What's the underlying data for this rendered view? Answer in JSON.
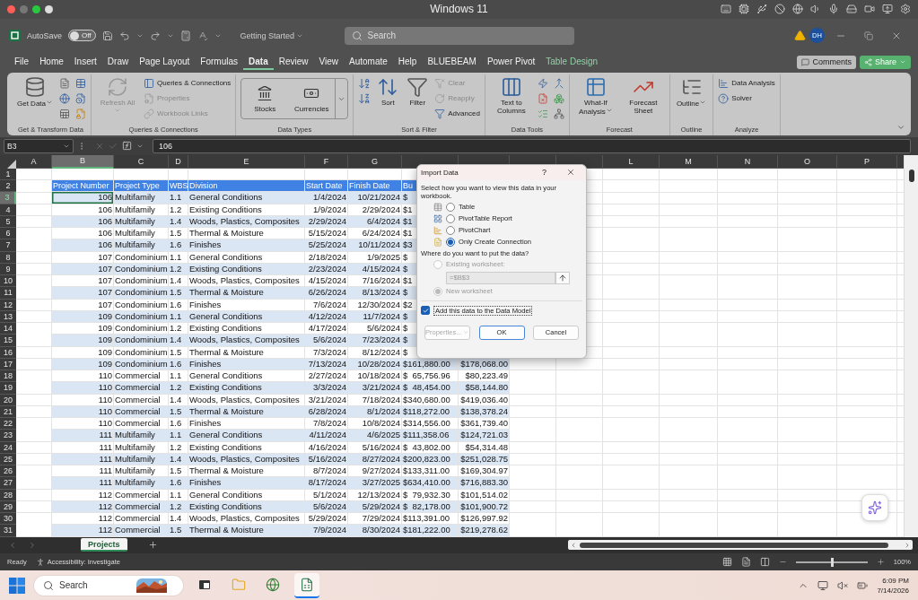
{
  "mac_titlebar": {
    "title": "Windows 11"
  },
  "app_titlebar": {
    "autosave_label": "AutoSave",
    "autosave": {
      "on": false,
      "label": "Off"
    },
    "document": "Getting Started",
    "search": {
      "placeholder": "Search"
    },
    "avatar": "DH"
  },
  "ribbon_tabs": [
    {
      "label": "File",
      "selected": false,
      "kind": "normal"
    },
    {
      "label": "Home",
      "selected": false,
      "kind": "normal"
    },
    {
      "label": "Insert",
      "selected": false,
      "kind": "normal"
    },
    {
      "label": "Draw",
      "selected": false,
      "kind": "normal"
    },
    {
      "label": "Page Layout",
      "selected": false,
      "kind": "normal"
    },
    {
      "label": "Formulas",
      "selected": false,
      "kind": "normal"
    },
    {
      "label": "Data",
      "selected": true,
      "kind": "normal"
    },
    {
      "label": "Review",
      "selected": false,
      "kind": "normal"
    },
    {
      "label": "View",
      "selected": false,
      "kind": "normal"
    },
    {
      "label": "Automate",
      "selected": false,
      "kind": "normal"
    },
    {
      "label": "Help",
      "selected": false,
      "kind": "normal"
    },
    {
      "label": "BLUEBEAM",
      "selected": false,
      "kind": "normal"
    },
    {
      "label": "Power Pivot",
      "selected": false,
      "kind": "normal"
    },
    {
      "label": "Table Design",
      "selected": false,
      "kind": "contextual"
    }
  ],
  "ribbon_actions": {
    "comments": "Comments",
    "share": "Share"
  },
  "ribbon_groups": [
    {
      "title": "Get & Transform Data",
      "items": [
        {
          "kind": "large",
          "label": "Get Data",
          "menu": true,
          "disabled": false
        }
      ]
    },
    {
      "title": "Queries & Connections",
      "items": [
        {
          "kind": "large",
          "label": "Refresh All",
          "menu": true,
          "disabled": true
        },
        {
          "kind": "small",
          "label": "Queries & Connections",
          "menu": false,
          "disabled": false
        },
        {
          "kind": "small",
          "label": "Properties",
          "menu": false,
          "disabled": true
        },
        {
          "kind": "small",
          "label": "Workbook Links",
          "menu": false,
          "disabled": true
        }
      ]
    },
    {
      "title": "Data Types",
      "items": [
        {
          "kind": "gallery",
          "label": "Stocks",
          "menu": false,
          "disabled": false
        },
        {
          "kind": "gallery",
          "label": "Currencies",
          "menu": false,
          "disabled": false
        }
      ]
    },
    {
      "title": "Sort & Filter",
      "items": [
        {
          "kind": "large",
          "label": "Sort",
          "menu": false,
          "disabled": false
        },
        {
          "kind": "large",
          "label": "Filter",
          "menu": false,
          "disabled": false
        },
        {
          "kind": "small",
          "label": "Clear",
          "menu": false,
          "disabled": true
        },
        {
          "kind": "small",
          "label": "Reapply",
          "menu": false,
          "disabled": true
        },
        {
          "kind": "small",
          "label": "Advanced",
          "menu": false,
          "disabled": false
        }
      ]
    },
    {
      "title": "Data Tools",
      "items": [
        {
          "kind": "large",
          "label": "Text to Columns",
          "menu": false,
          "disabled": false
        }
      ]
    },
    {
      "title": "Forecast",
      "items": [
        {
          "kind": "large",
          "label": "What-If Analysis",
          "menu": true,
          "disabled": false
        },
        {
          "kind": "large",
          "label": "Forecast Sheet",
          "menu": false,
          "disabled": false
        }
      ]
    },
    {
      "title": "Outline",
      "items": [
        {
          "kind": "large",
          "label": "Outline",
          "menu": true,
          "disabled": false
        }
      ]
    },
    {
      "title": "Analyze",
      "items": [
        {
          "kind": "small",
          "label": "Data Analysis",
          "menu": false,
          "disabled": false
        },
        {
          "kind": "small",
          "label": "Solver",
          "menu": false,
          "disabled": false
        }
      ]
    }
  ],
  "formula_bar": {
    "name_box": "B3",
    "formula": "106"
  },
  "sheet": {
    "column_headers": [
      {
        "letter": "A",
        "selected": false
      },
      {
        "letter": "B",
        "selected": true
      },
      {
        "letter": "C",
        "selected": false
      },
      {
        "letter": "D",
        "selected": false
      },
      {
        "letter": "E",
        "selected": false
      },
      {
        "letter": "F",
        "selected": false
      },
      {
        "letter": "G",
        "selected": false
      },
      {
        "selected": false
      },
      {
        "selected": false
      },
      {
        "selected": false
      },
      {
        "selected": false
      },
      {
        "letter": "L",
        "selected": false
      },
      {
        "letter": "M",
        "selected": false
      },
      {
        "letter": "N",
        "selected": false
      },
      {
        "letter": "O",
        "selected": false
      },
      {
        "letter": "P",
        "selected": false
      }
    ],
    "rows": [
      {
        "number": "1",
        "kind": "empty",
        "selected": false,
        "cells": []
      },
      {
        "number": "2",
        "kind": "header",
        "selected": false,
        "cells": [
          "Project Number",
          "Project Type",
          "WBS",
          "Division",
          "Start Date",
          "Finish Date",
          "Bu"
        ]
      },
      {
        "number": "3",
        "kind": "data",
        "selected": true,
        "cells": [
          "106",
          "Multifamily",
          "1.1",
          "General Conditions",
          "1/4/2024",
          "10/21/2024",
          "$"
        ]
      },
      {
        "number": "4",
        "kind": "data",
        "selected": false,
        "cells": [
          "106",
          "Multifamily",
          "1.2",
          "Existing Conditions",
          "1/9/2024",
          "2/29/2024",
          "$1"
        ]
      },
      {
        "number": "5",
        "kind": "data",
        "selected": false,
        "cells": [
          "106",
          "Multifamily",
          "1.4",
          "Woods, Plastics, Composites",
          "2/29/2024",
          "6/4/2024",
          "$1"
        ]
      },
      {
        "number": "6",
        "kind": "data",
        "selected": false,
        "cells": [
          "106",
          "Multifamily",
          "1.5",
          "Thermal & Moisture",
          "5/15/2024",
          "6/24/2024",
          "$1"
        ]
      },
      {
        "number": "7",
        "kind": "data",
        "selected": false,
        "cells": [
          "106",
          "Multifamily",
          "1.6",
          "Finishes",
          "5/25/2024",
          "10/11/2024",
          "$3"
        ]
      },
      {
        "number": "8",
        "kind": "data",
        "selected": false,
        "cells": [
          "107",
          "Condominium",
          "1.1",
          "General Conditions",
          "2/18/2024",
          "1/9/2025",
          "$"
        ]
      },
      {
        "number": "9",
        "kind": "data",
        "selected": false,
        "cells": [
          "107",
          "Condominium",
          "1.2",
          "Existing Conditions",
          "2/23/2024",
          "4/15/2024",
          "$"
        ]
      },
      {
        "number": "10",
        "kind": "data",
        "selected": false,
        "cells": [
          "107",
          "Condominium",
          "1.4",
          "Woods, Plastics, Composites",
          "4/15/2024",
          "7/16/2024",
          "$1"
        ]
      },
      {
        "number": "11",
        "kind": "data",
        "selected": false,
        "cells": [
          "107",
          "Condominium",
          "1.5",
          "Thermal & Moisture",
          "6/26/2024",
          "8/13/2024",
          "$"
        ]
      },
      {
        "number": "12",
        "kind": "data",
        "selected": false,
        "cells": [
          "107",
          "Condominium",
          "1.6",
          "Finishes",
          "7/6/2024",
          "12/30/2024",
          "$2"
        ]
      },
      {
        "number": "13",
        "kind": "data",
        "selected": false,
        "cells": [
          "109",
          "Condominium",
          "1.1",
          "General Conditions",
          "4/12/2024",
          "11/7/2024",
          "$"
        ]
      },
      {
        "number": "14",
        "kind": "data",
        "selected": false,
        "cells": [
          "109",
          "Condominium",
          "1.2",
          "Existing Conditions",
          "4/17/2024",
          "5/6/2024",
          "$"
        ]
      },
      {
        "number": "15",
        "kind": "data",
        "selected": false,
        "cells": [
          "109",
          "Condominium",
          "1.4",
          "Woods, Plastics, Composites",
          "5/6/2024",
          "7/23/2024",
          "$"
        ]
      },
      {
        "number": "16",
        "kind": "data",
        "selected": false,
        "cells": [
          "109",
          "Condominium",
          "1.5",
          "Thermal & Moisture",
          "7/3/2024",
          "8/12/2024",
          "$"
        ]
      },
      {
        "number": "17",
        "kind": "data",
        "selected": false,
        "cells": [
          "109",
          "Condominium",
          "1.6",
          "Finishes",
          "7/13/2024",
          "10/28/2024",
          "$161,880.00",
          "$178,068.00"
        ]
      },
      {
        "number": "18",
        "kind": "data",
        "selected": false,
        "cells": [
          "110",
          "Commercial",
          "1.1",
          "General Conditions",
          "2/27/2024",
          "10/18/2024",
          "$  65,756.96",
          "$80,223.49"
        ]
      },
      {
        "number": "19",
        "kind": "data",
        "selected": false,
        "cells": [
          "110",
          "Commercial",
          "1.2",
          "Existing Conditions",
          "3/3/2024",
          "3/21/2024",
          "$  48,454.00",
          "$58,144.80"
        ]
      },
      {
        "number": "20",
        "kind": "data",
        "selected": false,
        "cells": [
          "110",
          "Commercial",
          "1.4",
          "Woods, Plastics, Composites",
          "3/21/2024",
          "7/18/2024",
          "$340,680.00",
          "$419,036.40"
        ]
      },
      {
        "number": "21",
        "kind": "data",
        "selected": false,
        "cells": [
          "110",
          "Commercial",
          "1.5",
          "Thermal & Moisture",
          "6/28/2024",
          "8/1/2024",
          "$118,272.00",
          "$138,378.24"
        ]
      },
      {
        "number": "22",
        "kind": "data",
        "selected": false,
        "cells": [
          "110",
          "Commercial",
          "1.6",
          "Finishes",
          "7/8/2024",
          "10/8/2024",
          "$314,556.00",
          "$361,739.40"
        ]
      },
      {
        "number": "23",
        "kind": "data",
        "selected": false,
        "cells": [
          "111",
          "Multifamily",
          "1.1",
          "General Conditions",
          "4/11/2024",
          "4/6/2025",
          "$111,358.06",
          "$124,721.03"
        ]
      },
      {
        "number": "24",
        "kind": "data",
        "selected": false,
        "cells": [
          "111",
          "Multifamily",
          "1.2",
          "Existing Conditions",
          "4/16/2024",
          "5/16/2024",
          "$  43,802.00",
          "$54,314.48"
        ]
      },
      {
        "number": "25",
        "kind": "data",
        "selected": false,
        "cells": [
          "111",
          "Multifamily",
          "1.4",
          "Woods, Plastics, Composites",
          "5/16/2024",
          "8/27/2024",
          "$200,823.00",
          "$251,028.75"
        ]
      },
      {
        "number": "26",
        "kind": "data",
        "selected": false,
        "cells": [
          "111",
          "Multifamily",
          "1.5",
          "Thermal & Moisture",
          "8/7/2024",
          "9/27/2024",
          "$133,311.00",
          "$169,304.97"
        ]
      },
      {
        "number": "27",
        "kind": "data",
        "selected": false,
        "cells": [
          "111",
          "Multifamily",
          "1.6",
          "Finishes",
          "8/17/2024",
          "3/27/2025",
          "$634,410.00",
          "$716,883.30"
        ]
      },
      {
        "number": "28",
        "kind": "data",
        "selected": false,
        "cells": [
          "112",
          "Commercial",
          "1.1",
          "General Conditions",
          "5/1/2024",
          "12/13/2024",
          "$  79,932.30",
          "$101,514.02"
        ]
      },
      {
        "number": "29",
        "kind": "data",
        "selected": false,
        "cells": [
          "112",
          "Commercial",
          "1.2",
          "Existing Conditions",
          "5/6/2024",
          "5/29/2024",
          "$  82,178.00",
          "$101,900.72"
        ]
      },
      {
        "number": "30",
        "kind": "data",
        "selected": false,
        "cells": [
          "112",
          "Commercial",
          "1.4",
          "Woods, Plastics, Composites",
          "5/29/2024",
          "7/29/2024",
          "$113,391.00",
          "$126,997.92"
        ]
      },
      {
        "number": "31",
        "kind": "data",
        "selected": false,
        "cells": [
          "112",
          "Commercial",
          "1.5",
          "Thermal & Moisture",
          "7/9/2024",
          "8/30/2024",
          "$181,222.00",
          "$219,278.62"
        ]
      }
    ]
  },
  "dialog": {
    "title": "Import Data",
    "help": "?",
    "prompt": "Select how you want to view this data in your workbook.",
    "view_options": [
      {
        "label": "Table",
        "selected": false
      },
      {
        "label": "PivotTable Report",
        "selected": false
      },
      {
        "label": "PivotChart",
        "selected": false
      },
      {
        "label": "Only Create Connection",
        "selected": true
      }
    ],
    "placement_prompt": "Where do you want to put the data?",
    "placement_options": [
      {
        "label": "Existing worksheet:",
        "selected": false,
        "disabled": true
      },
      {
        "label": "New worksheet",
        "selected": true,
        "disabled": true
      }
    ],
    "range": "=$B$3",
    "data_model": {
      "label": "Add this data to the Data Model",
      "checked": true
    },
    "buttons": [
      {
        "label": "Properties...",
        "disabled": true,
        "menu": true,
        "default": false
      },
      {
        "label": "OK",
        "disabled": false,
        "menu": false,
        "default": true
      },
      {
        "label": "Cancel",
        "disabled": false,
        "menu": false,
        "default": false
      }
    ]
  },
  "sheet_tabs": [
    {
      "label": "Projects",
      "selected": true
    }
  ],
  "status_bar": {
    "ready": "Ready",
    "accessibility": "Accessibility: Investigate",
    "zoom": {
      "level": 0.5,
      "reading": "100%"
    }
  },
  "taskbar": {
    "search": {
      "placeholder": "Search"
    },
    "apps": [
      {
        "selected": false
      },
      {
        "selected": false
      },
      {
        "selected": false
      },
      {
        "selected": true
      }
    ],
    "time": "6:09 PM",
    "date": "7/14/2026"
  }
}
